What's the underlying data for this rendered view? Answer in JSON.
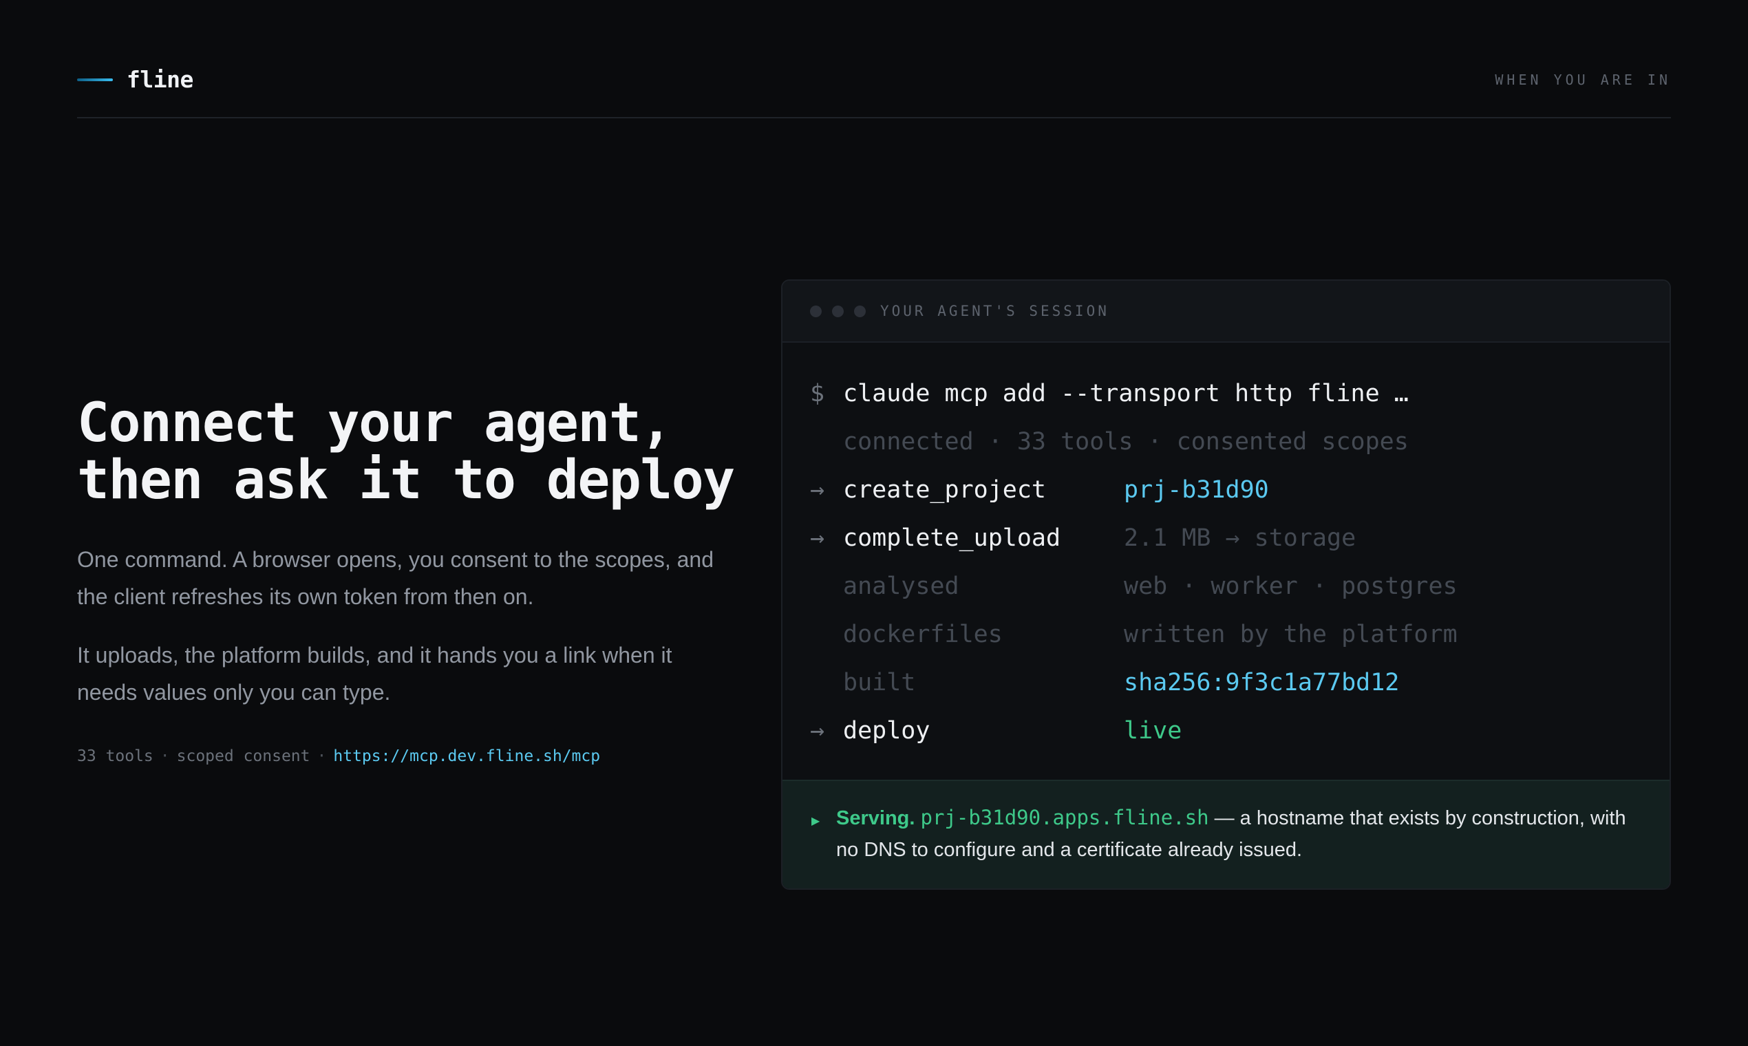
{
  "header": {
    "brand": "fline",
    "tagline": "WHEN YOU ARE IN"
  },
  "hero": {
    "title_line1": "Connect your agent,",
    "title_line2": "then ask it to deploy",
    "paragraph1": "One command. A browser opens, you consent to the scopes, and the client refreshes its own token from then on.",
    "paragraph2": "It uploads, the platform builds, and it hands you a link when it needs values only you can type.",
    "meta": {
      "tools": "33 tools",
      "separator": "·",
      "consent": "scoped consent",
      "url": "https://mcp.dev.fline.sh/mcp"
    }
  },
  "session": {
    "label": "YOUR AGENT'S SESSION",
    "prompt_symbol": "$",
    "arrow_symbol": "→",
    "command": "claude mcp add --transport http fline …",
    "status": "connected · 33 tools · consented scopes",
    "rows": [
      {
        "key": "create_project",
        "value": "prj-b31d90"
      },
      {
        "key": "complete_upload",
        "value": "2.1 MB → storage"
      },
      {
        "key": "analysed",
        "value": "web · worker · postgres"
      },
      {
        "key": "dockerfiles",
        "value": "written by the platform"
      },
      {
        "key": "built",
        "value": "sha256:9f3c1a77bd12"
      },
      {
        "key": "deploy",
        "value": "live"
      }
    ],
    "footer": {
      "icon": "triangle-right-icon",
      "lead": "Serving.",
      "hostname": "prj-b31d90.apps.fline.sh",
      "rest": "— a hostname that exists by construction, with no DNS to configure and a certificate already issued."
    }
  },
  "colors": {
    "accent_blue": "#5bc9f0",
    "accent_green": "#3ec98a",
    "background": "#0a0b0d"
  }
}
